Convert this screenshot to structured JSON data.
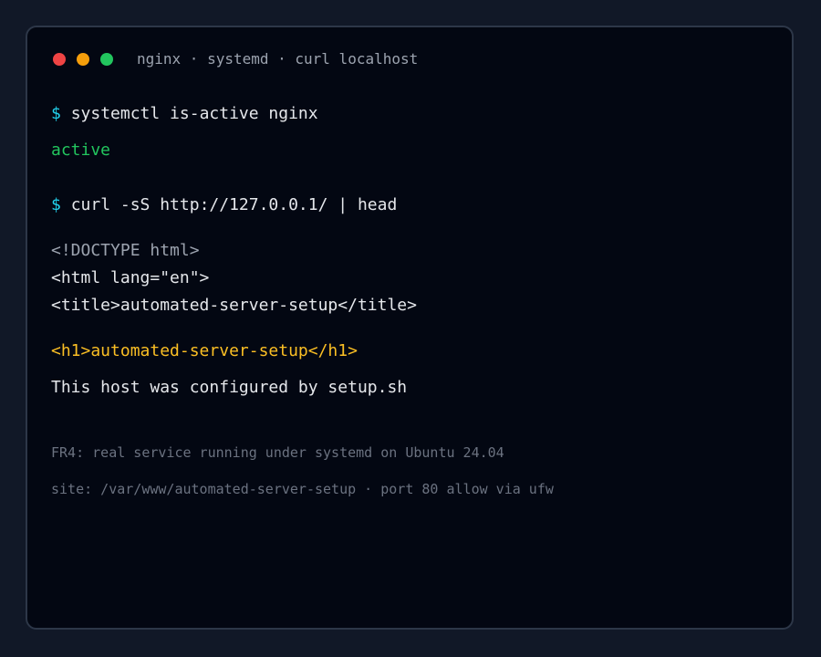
{
  "window": {
    "title": "nginx · systemd · curl localhost",
    "controls": [
      {
        "name": "close",
        "color": "#ef4444"
      },
      {
        "name": "minimize",
        "color": "#f59e0b"
      },
      {
        "name": "maximize",
        "color": "#22c55e"
      }
    ]
  },
  "terminal": {
    "prompt_symbol": "$",
    "cmd1": "systemctl is-active nginx",
    "out1": "active",
    "cmd2": "curl -sS http://127.0.0.1/ | head",
    "html_lines": [
      "<!DOCTYPE html>",
      "<html lang=\"en\">",
      "<title>automated-server-setup</title>",
      "<h1>automated-server-setup</h1>",
      "This host was configured by setup.sh"
    ]
  },
  "notes": {
    "fr4": "FR4: real service running under systemd on Ubuntu 24.04",
    "site": "site: /var/www/automated-server-setup · port 80 allow via ufw"
  },
  "colors": {
    "background": "#111827",
    "terminal_bg": "#030712",
    "prompt": "#22d3ee",
    "success": "#22c55e",
    "highlight": "#fbbf24",
    "muted": "#6b7280"
  }
}
